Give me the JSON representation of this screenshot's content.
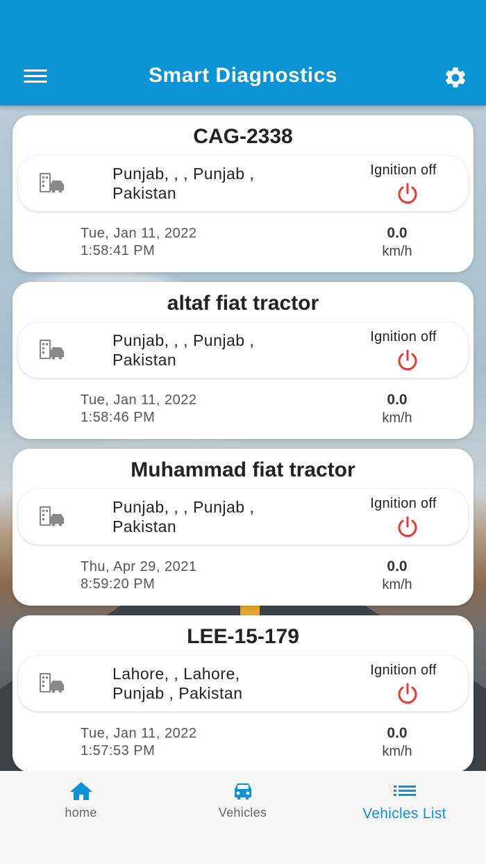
{
  "app": {
    "title": "Smart Diagnostics"
  },
  "colors": {
    "header": "#0b93d6",
    "accent": "#0b93d6",
    "ignition_off": "#e53935"
  },
  "header": {
    "menu_icon": "hamburger-menu-icon",
    "settings_icon": "gear-icon"
  },
  "vehicles": [
    {
      "name": "CAG-2338",
      "address_line1": "Punjab, , , Punjab ,",
      "address_line2": "Pakistan",
      "ignition": "Ignition off",
      "date": "Tue, Jan 11, 2022",
      "time": "1:58:41 PM",
      "speed": "0.0",
      "unit": "km/h"
    },
    {
      "name": "altaf fiat tractor",
      "address_line1": "Punjab, , , Punjab ,",
      "address_line2": "Pakistan",
      "ignition": "Ignition off",
      "date": "Tue, Jan 11, 2022",
      "time": "1:58:46 PM",
      "speed": "0.0",
      "unit": "km/h"
    },
    {
      "name": "Muhammad fiat tractor",
      "address_line1": "Punjab, , , Punjab ,",
      "address_line2": "Pakistan",
      "ignition": "Ignition off",
      "date": "Thu, Apr 29, 2021",
      "time": "8:59:20 PM",
      "speed": "0.0",
      "unit": "km/h"
    },
    {
      "name": "LEE-15-179",
      "address_line1": "Lahore, , Lahore,",
      "address_line2": "Punjab , Pakistan",
      "ignition": "Ignition off",
      "date": "Tue, Jan 11, 2022",
      "time": "1:57:53 PM",
      "speed": "0.0",
      "unit": "km/h"
    }
  ],
  "bottom_nav": {
    "items": [
      {
        "label": "home",
        "icon": "home-icon",
        "active": false
      },
      {
        "label": "Vehicles",
        "icon": "car-icon",
        "active": false
      },
      {
        "label": "Vehicles List",
        "icon": "list-icon",
        "active": true
      }
    ]
  }
}
